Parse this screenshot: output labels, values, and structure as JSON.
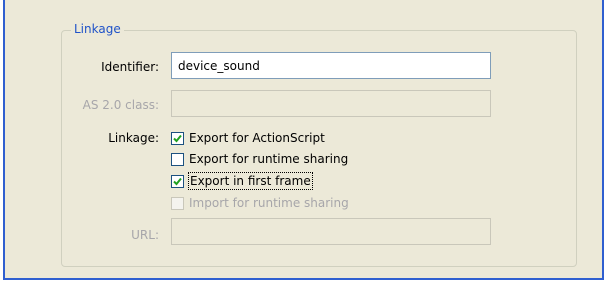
{
  "linkage_group": {
    "title": "Linkage",
    "identifier": {
      "label": "Identifier:",
      "value": "device_sound"
    },
    "as2_class": {
      "label": "AS 2.0 class:",
      "value": ""
    },
    "linkage": {
      "label": "Linkage:",
      "options": [
        {
          "label": "Export for ActionScript",
          "checked": true,
          "enabled": true
        },
        {
          "label": "Export for runtime sharing",
          "checked": false,
          "enabled": true
        },
        {
          "label": "Export in first frame",
          "checked": true,
          "enabled": true
        },
        {
          "label": "Import for runtime sharing",
          "checked": false,
          "enabled": false
        }
      ]
    },
    "url": {
      "label": "URL:",
      "value": ""
    }
  },
  "colors": {
    "panel_bg": "#ece9d8",
    "title_blue": "#1f52c8",
    "window_border": "#2f5fd0",
    "checkmark": "#21a121"
  }
}
